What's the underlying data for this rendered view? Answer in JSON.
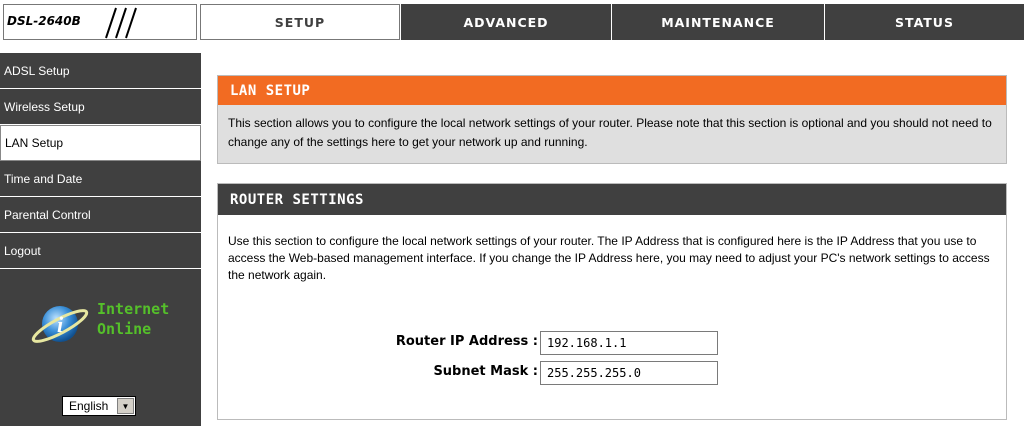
{
  "brand": {
    "model": "DSL-2640B"
  },
  "tabs": [
    {
      "label": "SETUP",
      "active": true
    },
    {
      "label": "ADVANCED",
      "active": false
    },
    {
      "label": "MAINTENANCE",
      "active": false
    },
    {
      "label": "STATUS",
      "active": false
    }
  ],
  "sidebar": {
    "items": [
      {
        "label": "ADSL Setup"
      },
      {
        "label": "Wireless Setup"
      },
      {
        "label": "LAN Setup",
        "active": true
      },
      {
        "label": "Time and Date"
      },
      {
        "label": "Parental Control"
      },
      {
        "label": "Logout"
      }
    ],
    "status_line1": "Internet",
    "status_line2": "Online",
    "language": "English"
  },
  "lan_setup": {
    "title": "LAN SETUP",
    "description": "This section allows you to configure the local network settings of your router. Please note that this section is optional and you should not need to change any of the settings here to get your network up and running."
  },
  "router_settings": {
    "title": "ROUTER SETTINGS",
    "description": "Use this section to configure the local network settings of your router. The IP Address that is configured here is the IP Address that you use to access the Web-based management interface. If you change the IP Address here, you may need to adjust your PC's network settings to access the network again.",
    "ip_label": "Router IP Address :",
    "ip_value": "192.168.1.1",
    "mask_label": "Subnet Mask :",
    "mask_value": "255.255.255.0"
  },
  "colors": {
    "accent": "#f26b22",
    "dark": "#404040",
    "online": "#55c02a"
  },
  "icons": {
    "status": "globe-icon",
    "dropdown": "chevron-down-icon"
  }
}
